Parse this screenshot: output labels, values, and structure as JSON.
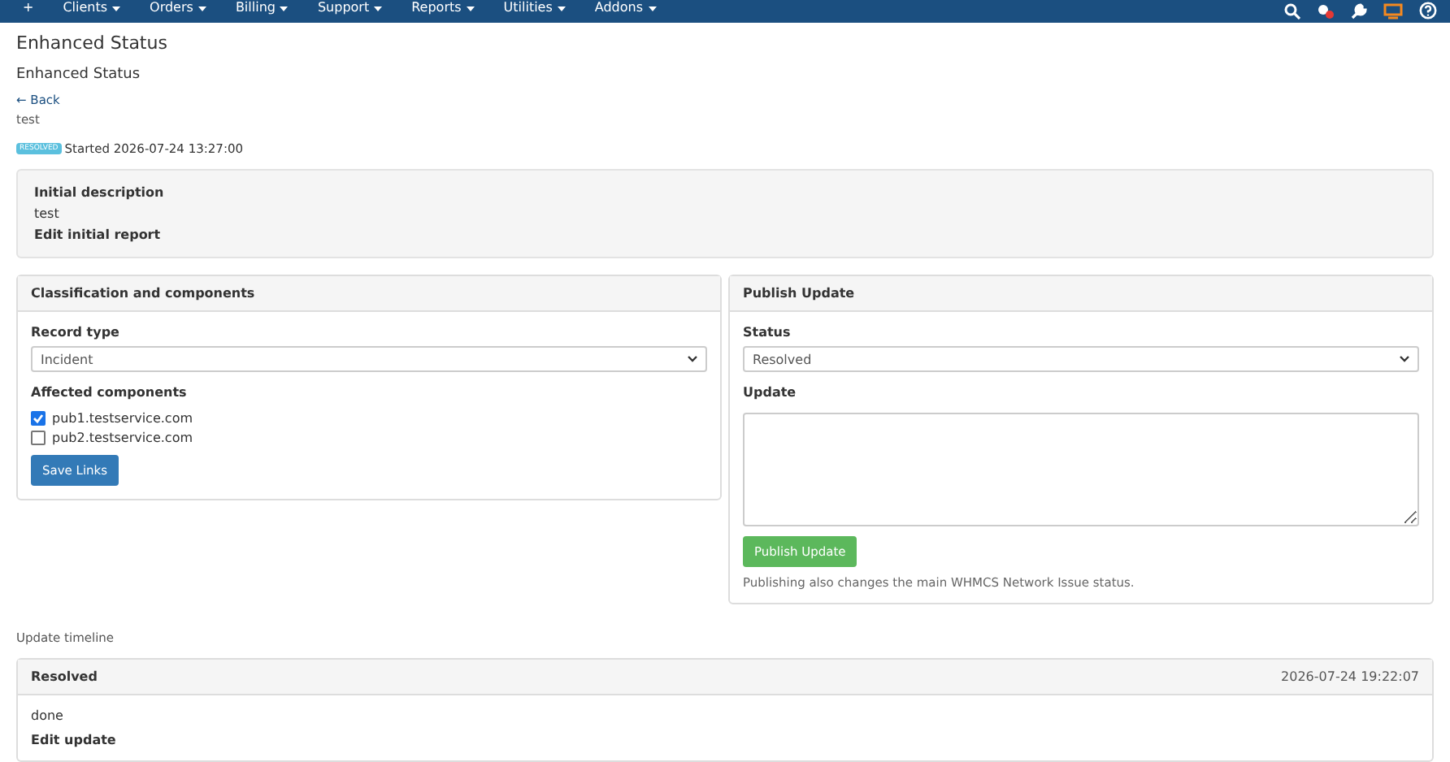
{
  "nav": {
    "add": "+",
    "items": [
      {
        "label": "Clients"
      },
      {
        "label": "Orders"
      },
      {
        "label": "Billing"
      },
      {
        "label": "Support"
      },
      {
        "label": "Reports"
      },
      {
        "label": "Utilities"
      },
      {
        "label": "Addons"
      }
    ]
  },
  "page_title": "Enhanced Status",
  "subtitle": "Enhanced Status",
  "back_link": "← Back",
  "issue_title": "test",
  "status_badge": "RESOLVED",
  "started": "Started 2026-07-24 13:27:00",
  "initial": {
    "label": "Initial description",
    "text": "test",
    "edit_link": "Edit initial report"
  },
  "classification": {
    "title": "Classification and components",
    "record_type_label": "Record type",
    "record_type": "Incident",
    "components_label": "Affected components",
    "components": [
      {
        "label": "pub1.testservice.com",
        "checked": true
      },
      {
        "label": "pub2.testservice.com",
        "checked": false
      }
    ],
    "save_button": "Save Links"
  },
  "publish": {
    "title": "Publish Update",
    "status_label": "Status",
    "status": "Resolved",
    "update_label": "Update",
    "button": "Publish Update",
    "note": "Publishing also changes the main WHMCS Network Issue status."
  },
  "timeline": {
    "label": "Update timeline",
    "entries": [
      {
        "status": "Resolved",
        "time": "2026-07-24 19:22:07",
        "text": "done",
        "edit_link": "Edit update"
      }
    ]
  }
}
